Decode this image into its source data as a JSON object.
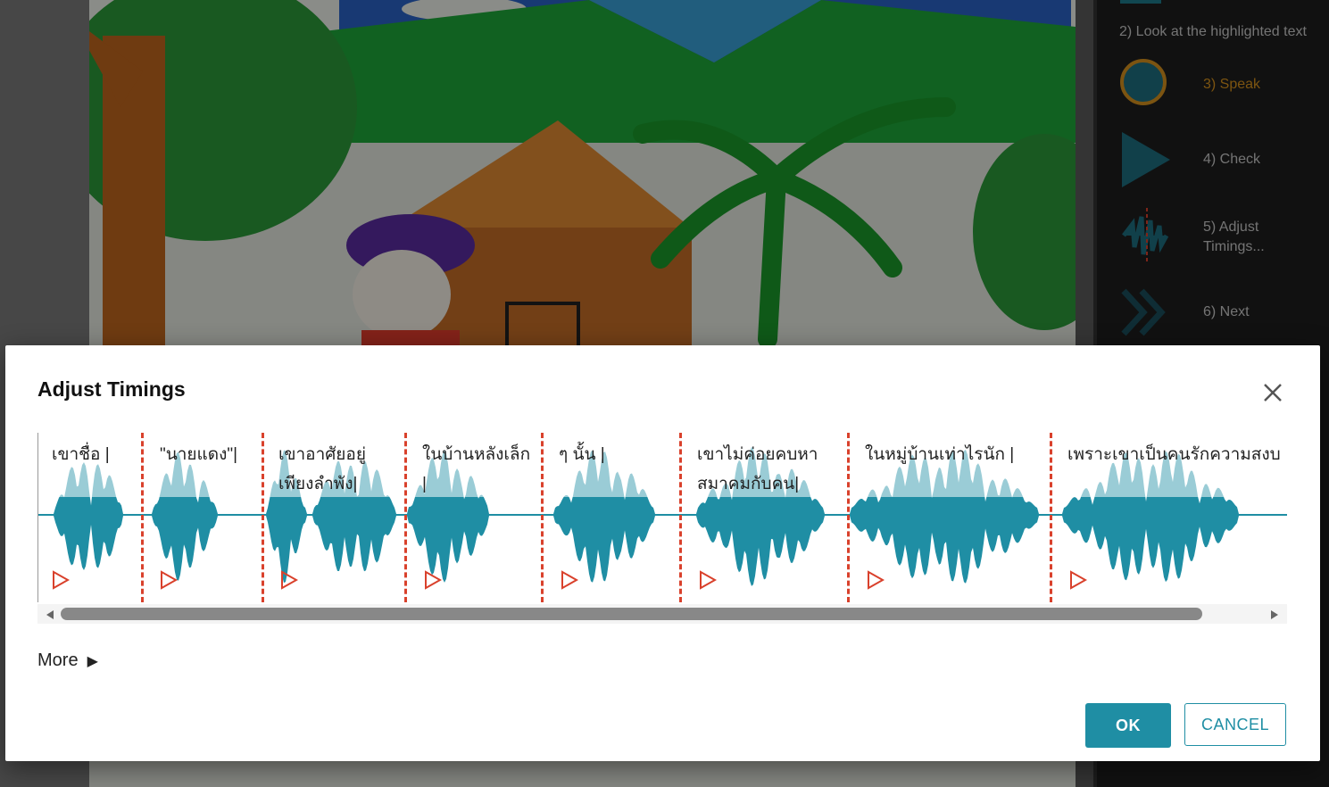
{
  "background": {
    "steps": [
      {
        "label": "2) Look at the highlighted text",
        "icon": "highlight-icon"
      },
      {
        "label": "3) Speak",
        "icon": "record-circle-icon",
        "color": "#d6911e"
      },
      {
        "label": "4) Check",
        "icon": "play-triangle-icon"
      },
      {
        "label": "5) Adjust Timings...",
        "icon": "adjust-waveform-icon"
      },
      {
        "label": "6) Next",
        "icon": "double-chevron-right-icon"
      }
    ]
  },
  "dialog": {
    "title": "Adjust Timings",
    "close_icon": "close-icon",
    "segments": [
      {
        "text": "เขาชื่อ |"
      },
      {
        "text": "\"นายแดง\"|"
      },
      {
        "text": "เขาอาศัยอยู่\nเพียงลำพัง|"
      },
      {
        "text": "ในบ้านหลังเล็ก\n|"
      },
      {
        "text": "ๆ นั้น |"
      },
      {
        "text": "เขาไม่ค่อยคบหา\nสมาคมกับคน|"
      },
      {
        "text": "ในหมู่บ้านเท่าไรนัก |"
      },
      {
        "text": "เพราะเขาเป็นคนรักความสงบ"
      }
    ],
    "more_label": "More",
    "ok_label": "OK",
    "cancel_label": "CANCEL",
    "colors": {
      "accent": "#1f8ea4",
      "boundary": "#d9412c",
      "speak": "#d6911e"
    }
  }
}
